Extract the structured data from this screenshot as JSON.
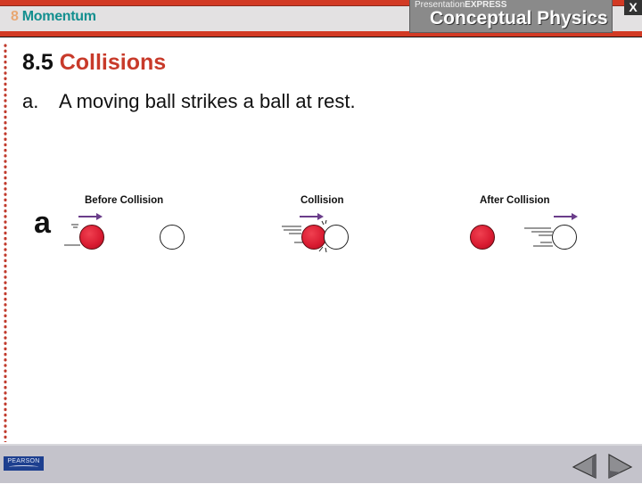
{
  "header": {
    "chapter_number": "8",
    "chapter_name": "Momentum",
    "brand_prefix_light": "Presentation",
    "brand_prefix_bold": "EXPRESS",
    "brand_title": "Conceptual Physics",
    "close_label": "X"
  },
  "slide": {
    "section_number": "8.5",
    "section_name": "Collisions",
    "bullets": [
      {
        "marker": "a.",
        "text": "A moving ball strikes a ball at rest."
      }
    ]
  },
  "figure": {
    "panel_letter": "a",
    "stages": [
      {
        "label": "Before Collision"
      },
      {
        "label": "Collision"
      },
      {
        "label": "After Collision"
      }
    ],
    "colors": {
      "moving_ball": "#d81a30",
      "rest_ball": "#ffffff",
      "arrow": "#6a3d8a"
    }
  },
  "footer": {
    "publisher": "PEARSON",
    "prev_icon": "triangle-left",
    "next_icon": "triangle-right"
  },
  "theme": {
    "accent_red": "#d23a24",
    "chapter_teal": "#138f8f",
    "footer_gray": "#c4c3cb"
  }
}
